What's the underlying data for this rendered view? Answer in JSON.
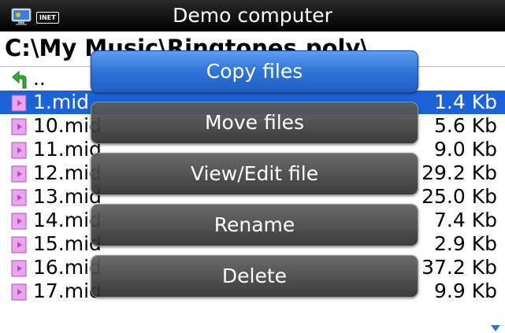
{
  "titlebar": {
    "title": "Demo computer",
    "badge": "INET"
  },
  "path": "C:\\My Music\\Ringtones.poly\\",
  "list": {
    "parent": "..",
    "files": [
      {
        "name": "1.mid",
        "size": "1.4 Kb",
        "selected": true
      },
      {
        "name": "10.mid",
        "size": "5.6 Kb"
      },
      {
        "name": "11.mid",
        "size": "9.0 Kb"
      },
      {
        "name": "12.mid",
        "size": "29.2 Kb"
      },
      {
        "name": "13.mid",
        "size": "25.0 Kb"
      },
      {
        "name": "14.mid",
        "size": "7.4 Kb"
      },
      {
        "name": "15.mid",
        "size": "2.9 Kb"
      },
      {
        "name": "16.mid",
        "size": "37.2 Kb"
      },
      {
        "name": "17.mid",
        "size": "9.9 Kb"
      }
    ]
  },
  "menu": {
    "items": [
      {
        "label": "Copy files",
        "active": true
      },
      {
        "label": "Move files"
      },
      {
        "label": "View/Edit file"
      },
      {
        "label": "Rename"
      },
      {
        "label": "Delete"
      }
    ]
  },
  "colors": {
    "selection": "#1b63d6",
    "titlebar": "#000000",
    "file_icon": "#e9a6ee"
  }
}
